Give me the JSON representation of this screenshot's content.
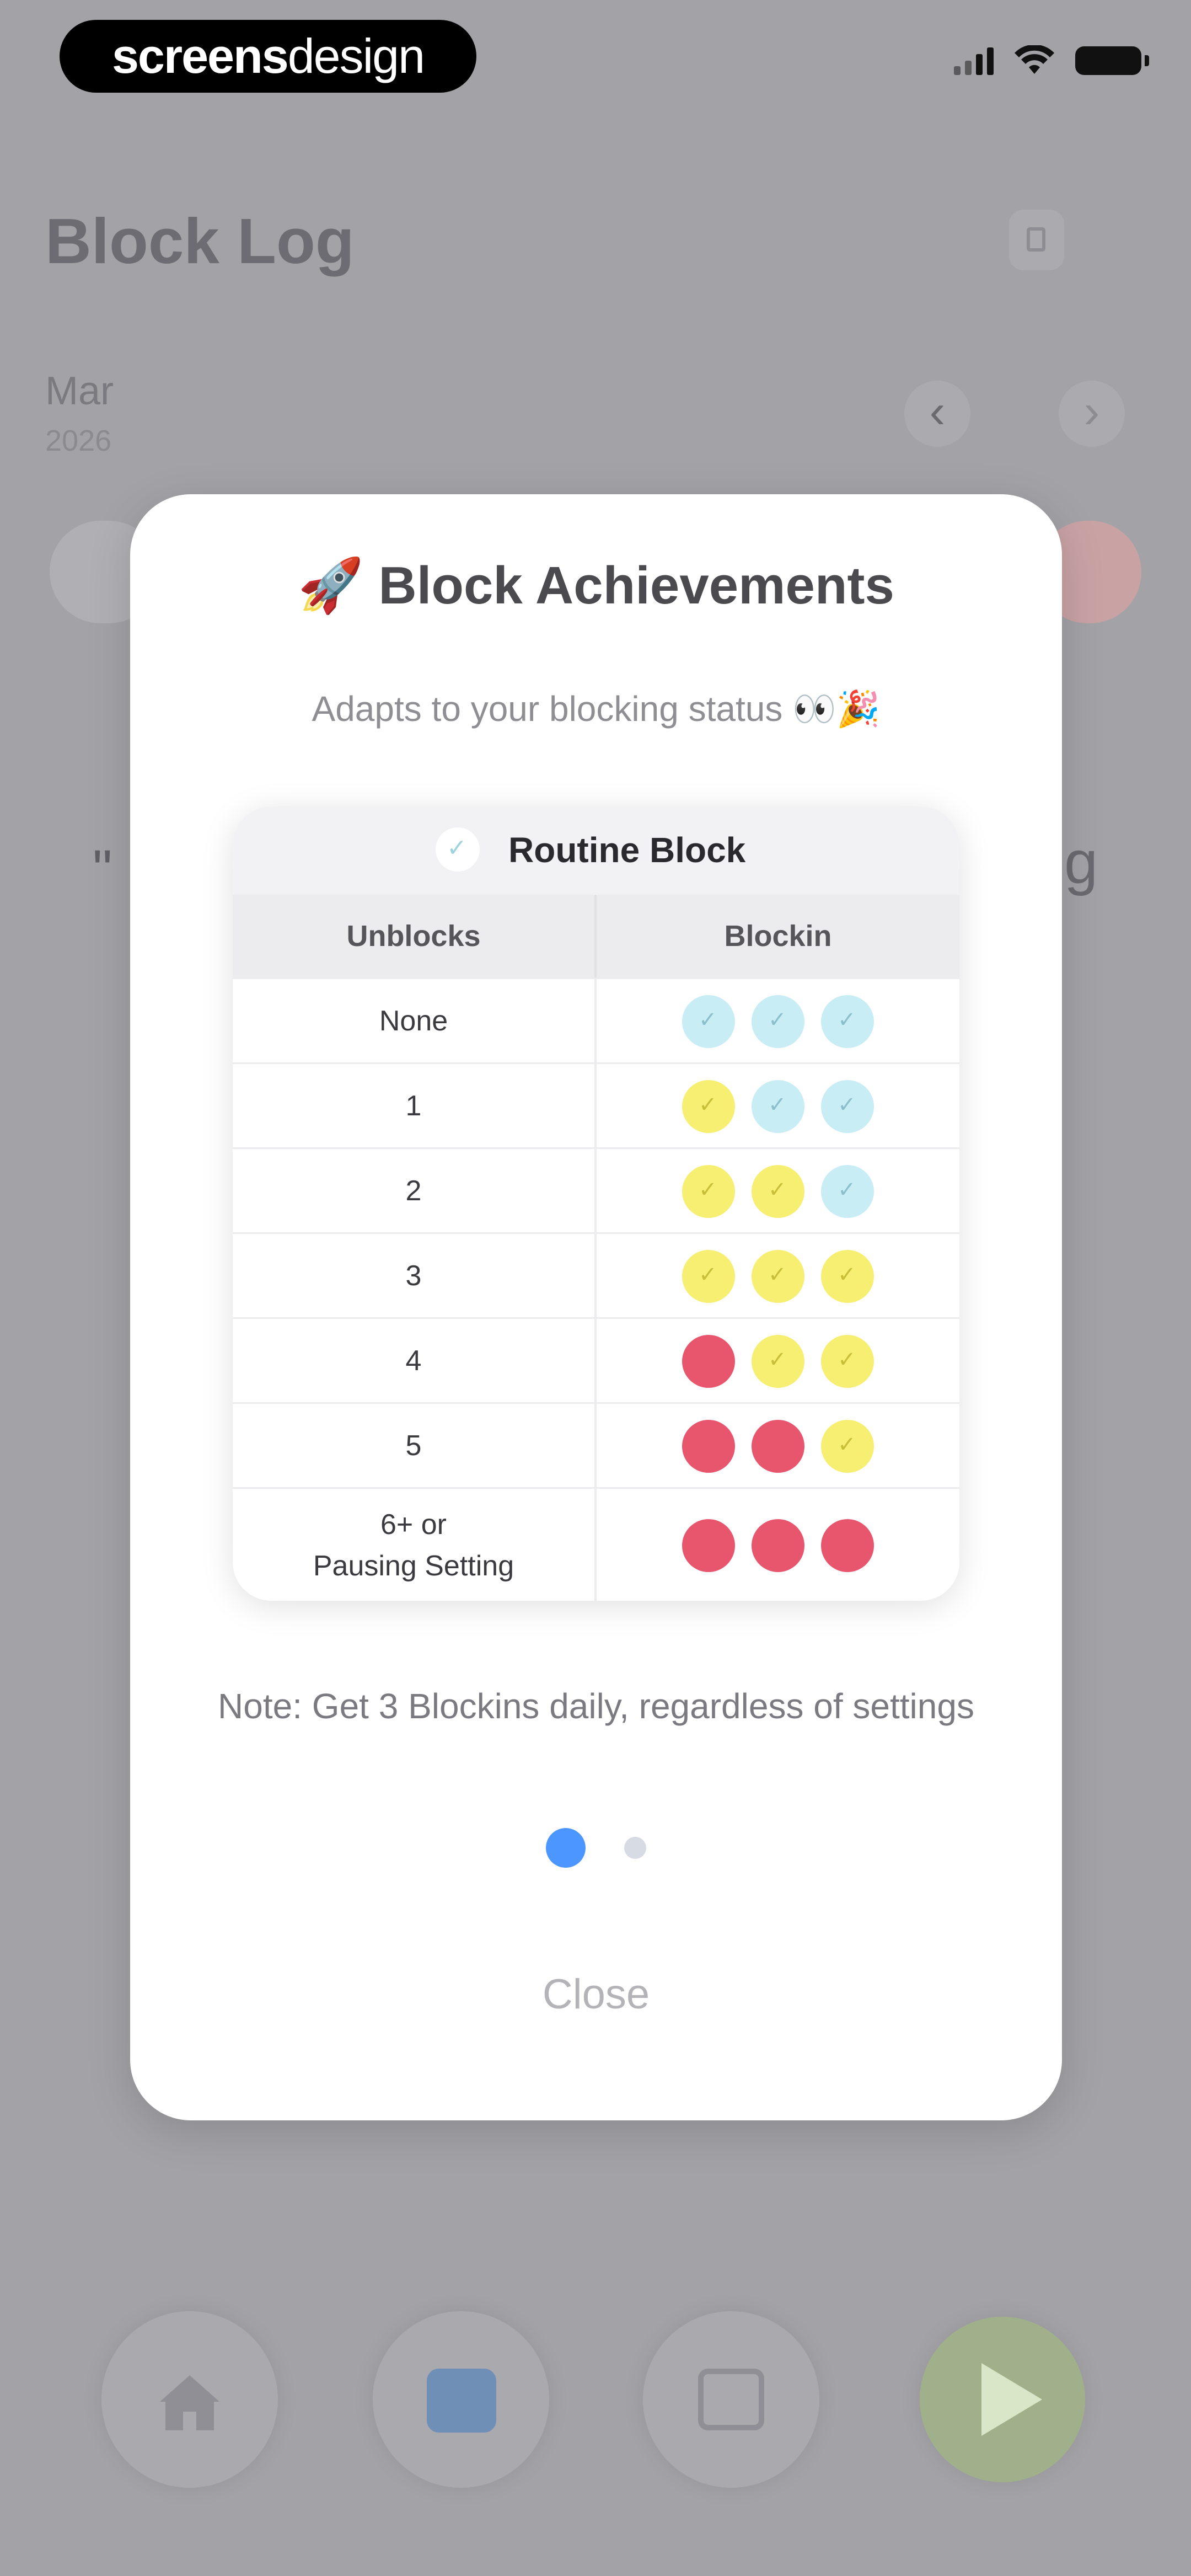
{
  "brand": {
    "bold": "screens",
    "light": "design"
  },
  "status_bar": {
    "signal_bars": 4,
    "wifi": "wifi-icon",
    "battery": "battery-icon"
  },
  "header": {
    "title": "Block Log",
    "action_icon": "info-icon"
  },
  "date_nav": {
    "month": "Mar",
    "year": "2026",
    "prev_icon": "chevron-left-icon",
    "next_icon": "chevron-right-icon"
  },
  "background_fragments": {
    "left": "\"",
    "right": "g"
  },
  "tabs": [
    {
      "icon": "home-icon"
    },
    {
      "icon": "calendar-icon"
    },
    {
      "icon": "photo-icon"
    },
    {
      "icon": "play-icon"
    }
  ],
  "modal": {
    "title": "🚀 Block Achievements",
    "subtitle": "Adapts to your blocking status 👀🎉",
    "table": {
      "card_title": "Routine Block",
      "headers": [
        "Unblocks",
        "Blockin"
      ],
      "rows": [
        {
          "label": "None",
          "dots": [
            "blue",
            "blue",
            "blue"
          ]
        },
        {
          "label": "1",
          "dots": [
            "yellow",
            "blue",
            "blue"
          ]
        },
        {
          "label": "2",
          "dots": [
            "yellow",
            "yellow",
            "blue"
          ]
        },
        {
          "label": "3",
          "dots": [
            "yellow",
            "yellow",
            "yellow"
          ]
        },
        {
          "label": "4",
          "dots": [
            "red",
            "yellow",
            "yellow"
          ]
        },
        {
          "label": "5",
          "dots": [
            "red",
            "red",
            "yellow"
          ]
        },
        {
          "label": "6+ or\nPausing Setting",
          "dots": [
            "red",
            "red",
            "red"
          ]
        }
      ]
    },
    "note": "Note: Get 3 Blockins daily, regardless of settings",
    "pager": {
      "current": 1,
      "total": 2
    },
    "close_label": "Close"
  },
  "colors": {
    "dot_blue": "#c9edf5",
    "dot_yellow": "#f6ef72",
    "dot_red": "#e8566e",
    "pager_active": "#4b96ff",
    "play_button": "#9fb08a"
  }
}
